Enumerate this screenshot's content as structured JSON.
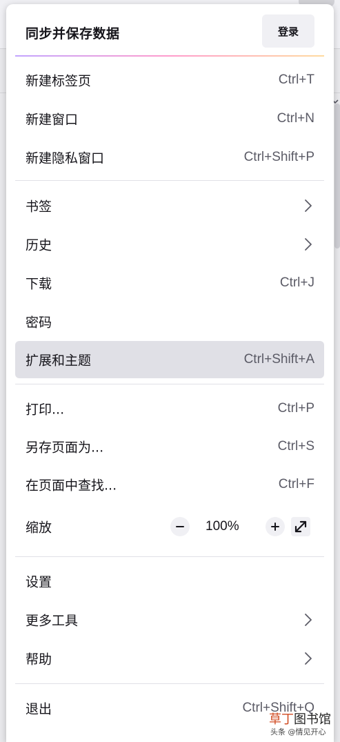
{
  "header": {
    "title": "同步并保存数据",
    "login_label": "登录"
  },
  "menu": {
    "new_tab": {
      "label": "新建标签页",
      "shortcut": "Ctrl+T"
    },
    "new_window": {
      "label": "新建窗口",
      "shortcut": "Ctrl+N"
    },
    "new_private_window": {
      "label": "新建隐私窗口",
      "shortcut": "Ctrl+Shift+P"
    },
    "bookmarks": {
      "label": "书签"
    },
    "history": {
      "label": "历史"
    },
    "downloads": {
      "label": "下载",
      "shortcut": "Ctrl+J"
    },
    "passwords": {
      "label": "密码"
    },
    "addons": {
      "label": "扩展和主题",
      "shortcut": "Ctrl+Shift+A"
    },
    "print": {
      "label": "打印...",
      "shortcut": "Ctrl+P"
    },
    "save_as": {
      "label": "另存页面为...",
      "shortcut": "Ctrl+S"
    },
    "find": {
      "label": "在页面中查找...",
      "shortcut": "Ctrl+F"
    },
    "zoom": {
      "label": "缩放",
      "value": "100%"
    },
    "settings": {
      "label": "设置"
    },
    "more_tools": {
      "label": "更多工具"
    },
    "help": {
      "label": "帮助"
    },
    "quit": {
      "label": "退出",
      "shortcut": "Ctrl+Shift+Q"
    }
  },
  "watermark": {
    "brand_first": "草丁",
    "brand_rest": "图书馆",
    "credit": "头条 @情见开心"
  },
  "colors": {
    "active_item_bg": "#e0e0e6",
    "shortcut_text": "#5b5b66"
  }
}
